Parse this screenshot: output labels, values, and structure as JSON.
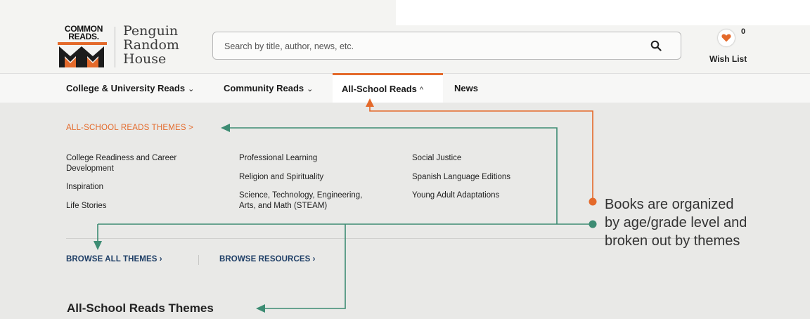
{
  "logo": {
    "common_reads_line1": "COMMON",
    "common_reads_line2": "READS.",
    "publisher_line1": "Penguin",
    "publisher_line2": "Random",
    "publisher_line3": "House"
  },
  "search": {
    "placeholder": "Search by title, author, news, etc.",
    "icon": "search-icon"
  },
  "wishlist": {
    "count": "0",
    "label": "Wish List",
    "icon": "heart-icon",
    "icon_color": "#e46a2b"
  },
  "nav": {
    "items": [
      {
        "label": "College & University Reads",
        "chevron": "⌄"
      },
      {
        "label": "Community Reads",
        "chevron": "⌄"
      },
      {
        "label": "All-School Reads",
        "chevron": "^"
      },
      {
        "label": "News"
      }
    ],
    "active_color": "#e46a2b"
  },
  "dropdown": {
    "themes_heading": "ALL-SCHOOL READS THEMES  >",
    "columns": [
      [
        "College Readiness and Career Development",
        "Inspiration",
        "Life Stories"
      ],
      [
        "Professional Learning",
        "Religion and Spirituality",
        "Science, Technology, Engineering, Arts, and Math (STEAM)"
      ],
      [
        "Social Justice",
        "Spanish Language Editions",
        "Young Adult Adaptations"
      ]
    ],
    "browse_all": "BROWSE ALL THEMES  ›",
    "browse_resources": "BROWSE RESOURCES  ›"
  },
  "section_title": "All-School Reads Themes",
  "annotation": {
    "line1": "Books are organized",
    "line2": "by age/grade level and",
    "line3": "broken out by themes",
    "orange": "#e46a2b",
    "green": "#3d8c73"
  }
}
